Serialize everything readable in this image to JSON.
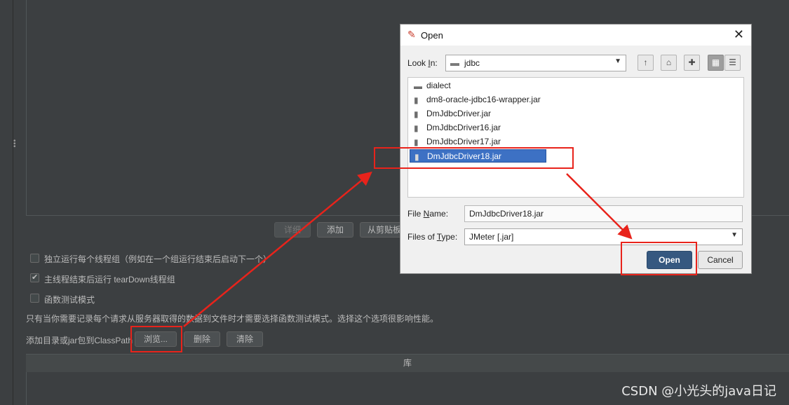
{
  "background_panel": {
    "buttons": {
      "details": "详细",
      "add": "添加",
      "add_from_clipboard": "从剪贴板"
    },
    "options": [
      {
        "label": "独立运行每个线程组（例如在一个组运行结束后启动下一个）",
        "checked": false
      },
      {
        "label": "主线程结束后运行 tearDown线程组",
        "checked": true
      },
      {
        "label": "函数测试模式",
        "checked": false
      }
    ],
    "info_text": "只有当你需要记录每个请求从服务器取得的数据到文件时才需要选择函数测试模式。选择这个选项很影响性能。",
    "classpath_label": "添加目录或jar包到ClassPath",
    "classpath_buttons": {
      "browse": "浏览...",
      "delete": "删除",
      "clear": "清除"
    },
    "library_header": "库"
  },
  "dialog": {
    "title": "Open",
    "look_in_label_prefix": "Look ",
    "look_in_label_mnemonic": "I",
    "look_in_label_suffix": "n:",
    "look_in_value": "jdbc",
    "toolbar_icons": [
      "up-folder-icon",
      "home-icon",
      "new-folder-icon",
      "list-view-icon",
      "details-view-icon"
    ],
    "files": [
      {
        "name": "dialect",
        "type": "folder",
        "selected": false
      },
      {
        "name": "dm8-oracle-jdbc16-wrapper.jar",
        "type": "file",
        "selected": false
      },
      {
        "name": "DmJdbcDriver.jar",
        "type": "file",
        "selected": false
      },
      {
        "name": "DmJdbcDriver16.jar",
        "type": "file",
        "selected": false
      },
      {
        "name": "DmJdbcDriver17.jar",
        "type": "file",
        "selected": false
      },
      {
        "name": "DmJdbcDriver18.jar",
        "type": "file",
        "selected": true
      }
    ],
    "file_name_label_prefix": "File ",
    "file_name_label_mnemonic": "N",
    "file_name_label_suffix": "ame:",
    "file_name_value": "DmJdbcDriver18.jar",
    "files_of_type_label_prefix": "Files of ",
    "files_of_type_label_mnemonic": "T",
    "files_of_type_label_suffix": "ype:",
    "files_of_type_value": "JMeter [.jar]",
    "open_button": "Open",
    "cancel_button": "Cancel"
  },
  "annotation_color": "#e8231b",
  "watermark": "CSDN @小光头的java日记"
}
